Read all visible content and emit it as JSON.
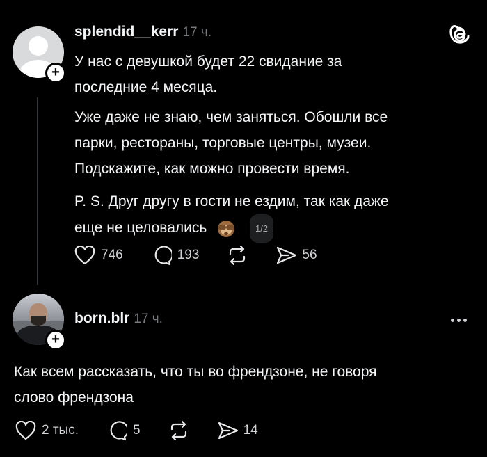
{
  "post1": {
    "username": "splendid__kerr",
    "time": "17 ч.",
    "text_1": "У нас с девушкой будет 22 свидание за",
    "text_2": "последние 4 месяца.",
    "text_3": "Уже даже не знаю, чем заняться. Обошли все",
    "text_4": "парки, рестораны, торговые центры, музеи.",
    "text_5": "Подскажите, как можно провести время.",
    "text_6": "P. S. Друг другу в гости не ездим, так как даже",
    "text_7": "еще не целовались",
    "emoji_icon": "see-no-evil-monkey",
    "pager": "1/2",
    "likes": "746",
    "comments": "193",
    "shares": "56"
  },
  "post2": {
    "username": "born.blr",
    "time": "17 ч.",
    "text_1": "Как всем рассказать, что ты во френдзоне, не говоря",
    "text_2": "слово френдзона",
    "likes": "2 тыс.",
    "comments": "5",
    "shares": "14"
  },
  "icons": {
    "app_logo": "threads-icon",
    "more": "more-dots-icon",
    "like": "heart-icon",
    "comment": "comment-bubble-icon",
    "repost": "repost-icon",
    "share": "send-icon"
  },
  "colors": {
    "background": "#000000",
    "text": "#f3f5f7",
    "muted": "#777a7e"
  }
}
